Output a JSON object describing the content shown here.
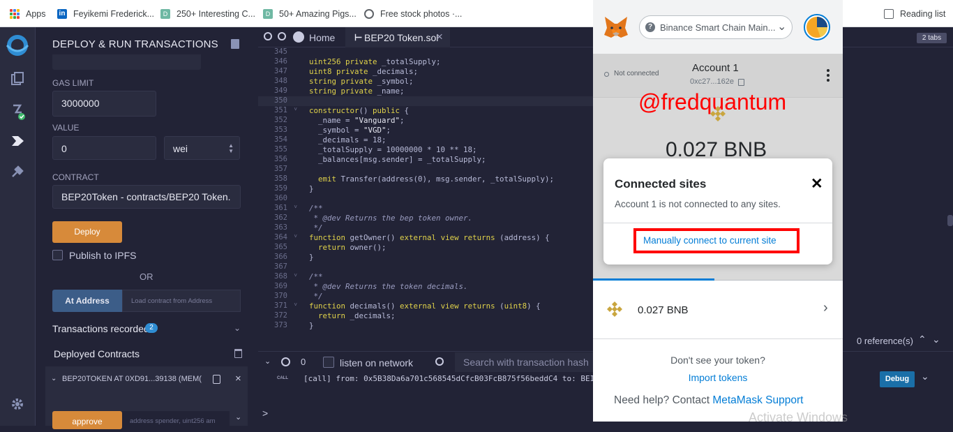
{
  "bookmarks": {
    "items": [
      {
        "label": "Apps",
        "icon": "apps-grid-icon"
      },
      {
        "label": "Feyikemi Frederick...",
        "icon": "linkedin-icon"
      },
      {
        "label": "250+ Interesting C...",
        "icon": "site-icon"
      },
      {
        "label": "50+ Amazing Pigs...",
        "icon": "site-icon"
      },
      {
        "label": "Free stock photos ·...",
        "icon": "globe-icon"
      }
    ],
    "reading_list": "Reading list"
  },
  "panel": {
    "title": "DEPLOY & RUN TRANSACTIONS",
    "gas_limit_label": "GAS LIMIT",
    "gas_limit_value": "3000000",
    "value_label": "VALUE",
    "value_value": "0",
    "value_unit": "wei",
    "contract_label": "CONTRACT",
    "contract_value": "BEP20Token - contracts/BEP20 Token.",
    "deploy_label": "Deploy",
    "publish_label": "Publish to IPFS",
    "or_label": "OR",
    "at_address_label": "At Address",
    "at_address_placeholder": "Load contract from Address",
    "transactions_recorded_label": "Transactions recorded",
    "transactions_recorded_count": "2",
    "deployed_contracts_label": "Deployed Contracts",
    "deployed_item": "BEP20TOKEN AT 0XD91...39138 (MEM(",
    "approve_label": "approve",
    "approve_placeholder": "address spender, uint256 am"
  },
  "editor": {
    "home_tab": "Home",
    "file_tab": "BEP20 Token.sol",
    "tabs_count": "2 tabs",
    "references": "0 reference(s)",
    "lines": [
      {
        "n": "345",
        "t": ""
      },
      {
        "n": "346",
        "t": "uint256 private _totalSupply;"
      },
      {
        "n": "347",
        "t": "uint8 private _decimals;"
      },
      {
        "n": "348",
        "t": "string private _symbol;"
      },
      {
        "n": "349",
        "t": "string private _name;"
      },
      {
        "n": "350",
        "t": ""
      },
      {
        "n": "351",
        "t": "constructor() public {"
      },
      {
        "n": "352",
        "t": "  _name = \"Vanguard\";"
      },
      {
        "n": "353",
        "t": "  _symbol = \"VGD\";"
      },
      {
        "n": "354",
        "t": "  _decimals = 18;"
      },
      {
        "n": "355",
        "t": "  _totalSupply = 10000000 * 10 ** 18;"
      },
      {
        "n": "356",
        "t": "  _balances[msg.sender] = _totalSupply;"
      },
      {
        "n": "357",
        "t": ""
      },
      {
        "n": "358",
        "t": "  emit Transfer(address(0), msg.sender, _totalSupply);"
      },
      {
        "n": "359",
        "t": "}"
      },
      {
        "n": "360",
        "t": ""
      },
      {
        "n": "361",
        "t": "/**"
      },
      {
        "n": "362",
        "t": " * @dev Returns the bep token owner."
      },
      {
        "n": "363",
        "t": " */"
      },
      {
        "n": "364",
        "t": "function getOwner() external view returns (address) {"
      },
      {
        "n": "365",
        "t": "  return owner();"
      },
      {
        "n": "366",
        "t": "}"
      },
      {
        "n": "367",
        "t": ""
      },
      {
        "n": "368",
        "t": "/**"
      },
      {
        "n": "369",
        "t": " * @dev Returns the token decimals."
      },
      {
        "n": "370",
        "t": " */"
      },
      {
        "n": "371",
        "t": "function decimals() external view returns (uint8) {"
      },
      {
        "n": "372",
        "t": "  return _decimals;"
      },
      {
        "n": "373",
        "t": "}"
      }
    ]
  },
  "terminal": {
    "count": "0",
    "listen_label": "listen on network",
    "search_placeholder": "Search with transaction hash",
    "log_tag": "CALL",
    "log_text": "[call]  from: 0x5B38Da6a701c568545dCfcB03FcB875f56beddC4 to: BEI",
    "debug_label": "Debug",
    "prompt": ">"
  },
  "metamask": {
    "network": "Binance Smart Chain Main...",
    "not_connected": "Not connected",
    "account_name": "Account 1",
    "account_address": "0xc27...162e",
    "balance": "0.027 BNB",
    "watermark": "@fredquantum",
    "modal_title": "Connected sites",
    "modal_text": "Account 1 is not connected to any sites.",
    "modal_link": "Manually connect to current site",
    "asset_balance": "0.027 BNB",
    "dont_see": "Don't see your token?",
    "import_tokens": "Import tokens",
    "need_help": "Need help? Contact ",
    "support_link": "MetaMask Support"
  },
  "os": {
    "activate_windows": "Activate Windows"
  },
  "colors": {
    "remix_bg": "#222336",
    "deploy_orange": "#d78a3a",
    "metamask_blue": "#037dd6",
    "highlight_red": "#ff0000",
    "bnb_gold": "#f0b90b"
  }
}
